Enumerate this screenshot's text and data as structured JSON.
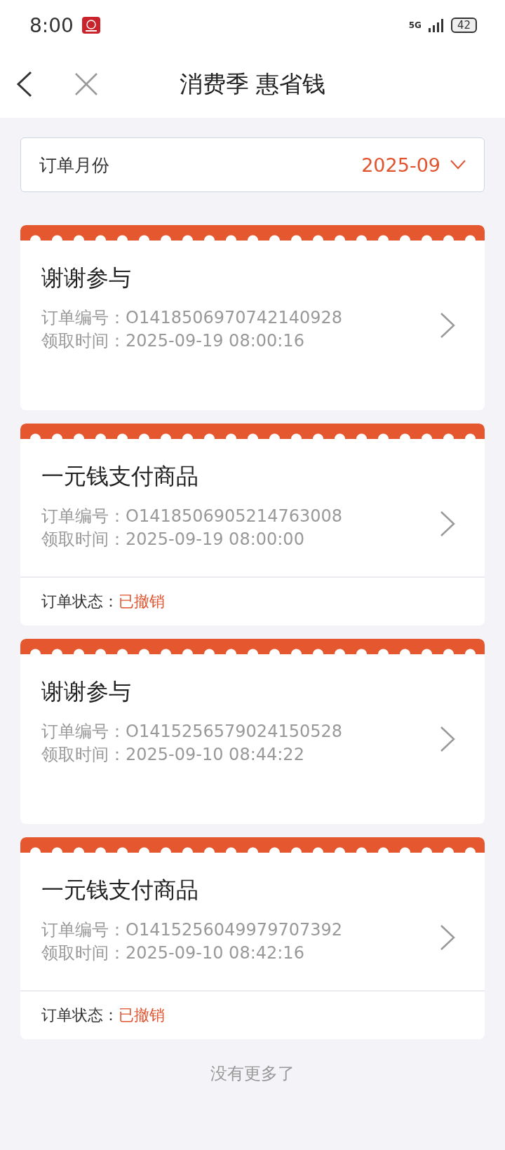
{
  "status_bar": {
    "time": "8:00",
    "network": "5G",
    "battery": "42"
  },
  "nav": {
    "title": "消费季 惠省钱"
  },
  "month_filter": {
    "label": "订单月份",
    "value": "2025-09"
  },
  "orders": [
    {
      "title": "谢谢参与",
      "order_label": "订单编号：",
      "order_no": "O1418506970742140928",
      "time_label": "领取时间：",
      "time": "2025-09-19 08:00:16"
    },
    {
      "title": "一元钱支付商品",
      "order_label": "订单编号：",
      "order_no": "O1418506905214763008",
      "time_label": "领取时间：",
      "time": "2025-09-19 08:00:00",
      "status_label": "订单状态：",
      "status": "已撤销"
    },
    {
      "title": "谢谢参与",
      "order_label": "订单编号：",
      "order_no": "O1415256579024150528",
      "time_label": "领取时间：",
      "time": "2025-09-10 08:44:22"
    },
    {
      "title": "一元钱支付商品",
      "order_label": "订单编号：",
      "order_no": "O1415256049979707392",
      "time_label": "领取时间：",
      "time": "2025-09-10 08:42:16",
      "status_label": "订单状态：",
      "status": "已撤销"
    }
  ],
  "footer": "没有更多了"
}
